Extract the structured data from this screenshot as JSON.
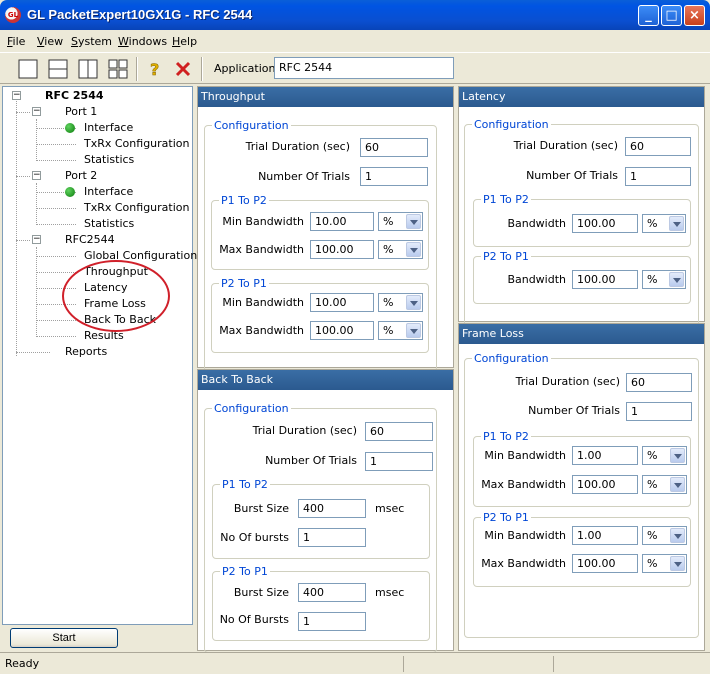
{
  "window": {
    "title": "GL PacketExpert10GX1G - RFC 2544",
    "icon_text": "GL"
  },
  "menu": [
    "File",
    "View",
    "System",
    "Windows",
    "Help"
  ],
  "menu_accel": [
    "F",
    "V",
    "S",
    "W",
    "H"
  ],
  "toolbar": {
    "icons": [
      "single-view-icon",
      "split-horizontal-icon",
      "split-vertical-icon",
      "quad-view-icon",
      "help-icon",
      "close-x-icon"
    ],
    "application_label": "Application:",
    "application_value": "RFC 2544"
  },
  "tree": {
    "root": "RFC 2544",
    "port1": {
      "label": "Port 1",
      "children": [
        "Interface",
        "TxRx Configuration",
        "Statistics"
      ]
    },
    "port2": {
      "label": "Port 2",
      "children": [
        "Interface",
        "TxRx Configuration",
        "Statistics"
      ]
    },
    "rfc": {
      "label": "RFC2544",
      "children": [
        "Global Configuration",
        "Throughput",
        "Latency",
        "Frame Loss",
        "Back To Back",
        "Results"
      ]
    },
    "reports": "Reports"
  },
  "start_button": "Start",
  "throughput": {
    "title": "Throughput",
    "config_label": "Configuration",
    "trial_duration_label": "Trial Duration (sec)",
    "trial_duration": "60",
    "num_trials_label": "Number Of Trials",
    "num_trials": "1",
    "p1p2_label": "P1 To P2",
    "p1p2_min_label": "Min Bandwidth",
    "p1p2_min": "10.00",
    "p1p2_min_unit": "%",
    "p1p2_max_label": "Max Bandwidth",
    "p1p2_max": "100.00",
    "p1p2_max_unit": "%",
    "p2p1_label": "P2 To P1",
    "p2p1_min_label": "Min Bandwidth",
    "p2p1_min": "10.00",
    "p2p1_min_unit": "%",
    "p2p1_max_label": "Max Bandwidth",
    "p2p1_max": "100.00",
    "p2p1_max_unit": "%"
  },
  "latency": {
    "title": "Latency",
    "config_label": "Configuration",
    "trial_duration_label": "Trial Duration (sec)",
    "trial_duration": "60",
    "num_trials_label": "Number Of Trials",
    "num_trials": "1",
    "p1p2_label": "P1 To P2",
    "p1p2_bw_label": "Bandwidth",
    "p1p2_bw": "100.00",
    "p1p2_unit": "%",
    "p2p1_label": "P2 To P1",
    "p2p1_bw_label": "Bandwidth",
    "p2p1_bw": "100.00",
    "p2p1_unit": "%"
  },
  "back_to_back": {
    "title": "Back To Back",
    "config_label": "Configuration",
    "trial_duration_label": "Trial Duration (sec)",
    "trial_duration": "60",
    "num_trials_label": "Number Of Trials",
    "num_trials": "1",
    "p1p2_label": "P1 To P2",
    "p1p2_burst_label": "Burst Size",
    "p1p2_burst": "400",
    "p1p2_burst_unit": "msec",
    "p1p2_count_label": "No Of bursts",
    "p1p2_count": "1",
    "p2p1_label": "P2 To P1",
    "p2p1_burst_label": "Burst Size",
    "p2p1_burst": "400",
    "p2p1_burst_unit": "msec",
    "p2p1_count_label": "No Of Bursts",
    "p2p1_count": "1"
  },
  "frame_loss": {
    "title": "Frame Loss",
    "config_label": "Configuration",
    "trial_duration_label": "Trial Duration (sec)",
    "trial_duration": "60",
    "num_trials_label": "Number Of Trials",
    "num_trials": "1",
    "p1p2_label": "P1 To P2",
    "p1p2_min_label": "Min Bandwidth",
    "p1p2_min": "1.00",
    "p1p2_min_unit": "%",
    "p1p2_max_label": "Max Bandwidth",
    "p1p2_max": "100.00",
    "p1p2_max_unit": "%",
    "p2p1_label": "P2 To P1",
    "p2p1_min_label": "Min Bandwidth",
    "p2p1_min": "1.00",
    "p2p1_min_unit": "%",
    "p2p1_max_label": "Max Bandwidth",
    "p2p1_max": "100.00",
    "p2p1_max_unit": "%"
  },
  "status": {
    "text": "Ready"
  },
  "colors": {
    "title_bar": "#0054e3",
    "panel_header": "#3a6ea5",
    "group_label": "#0046d5",
    "annotation_circle": "#d0202a",
    "status_dot": "#0a7a0a"
  }
}
